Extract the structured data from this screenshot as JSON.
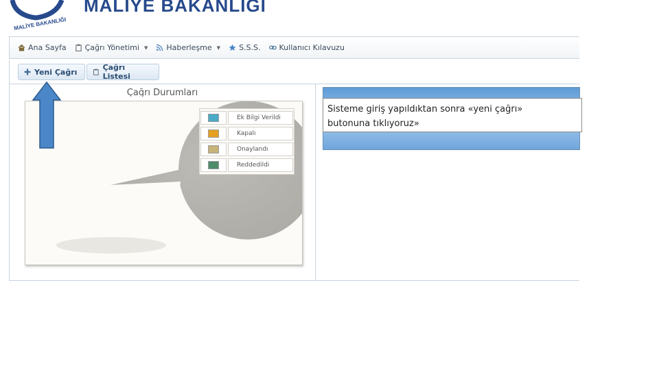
{
  "header": {
    "title": "MALİYE BAKANLIĞI",
    "logo_text": "MALİYE BAKANLIĞI"
  },
  "nav": {
    "items": [
      {
        "label": "Ana Sayfa",
        "icon": "home-icon",
        "dropdown": false
      },
      {
        "label": "Çağrı Yönetimi",
        "icon": "clipboard-icon",
        "dropdown": true
      },
      {
        "label": "Haberleşme",
        "icon": "rss-icon",
        "dropdown": true
      },
      {
        "label": "S.S.S.",
        "icon": "star-icon",
        "dropdown": false
      },
      {
        "label": "Kullanıcı Kılavuzu",
        "icon": "link-icon",
        "dropdown": false
      }
    ]
  },
  "toolbar": {
    "new_call_label": "Yeni Çağrı",
    "call_list_label": "Çağrı Listesi"
  },
  "panel": {
    "title": "Çağrı Durumları"
  },
  "legend": [
    {
      "label": "Ek Bilgi Verildi",
      "color": "#4aaac8"
    },
    {
      "label": "Kapalı",
      "color": "#e6a020"
    },
    {
      "label": "Onaylandı",
      "color": "#c8b478"
    },
    {
      "label": "Reddedildi",
      "color": "#4e8c6a"
    }
  ],
  "callout": {
    "line1": "Sisteme giriş yapıldıktan sonra «yeni çağrı»",
    "line2": "butonuna tıklıyoruz»"
  },
  "colors": {
    "pie": "#b6b4af",
    "accent": "#4a86c8",
    "title": "#274a8c"
  }
}
